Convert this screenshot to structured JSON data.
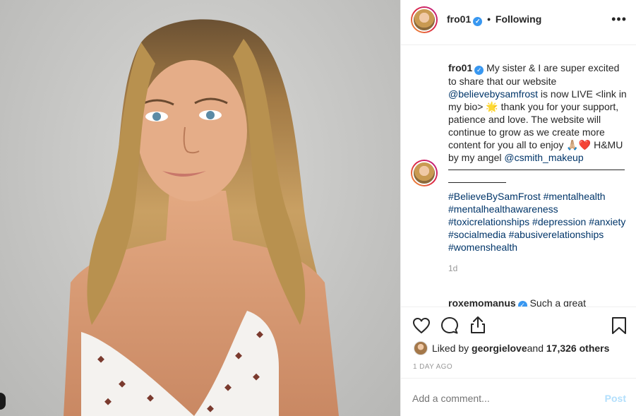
{
  "header": {
    "username": "fro01",
    "verified_mark": "✓",
    "separator": "•",
    "follow_status": "Following",
    "more_label": "•••"
  },
  "caption": {
    "username": "fro01",
    "verified_mark": "✓",
    "line1": "My sister & I are super excited to share that our website ",
    "mention1": "@believebysamfrost",
    "line2": " is now LIVE <link in my bio> ",
    "emoji1": "🌟",
    "line3": " thank you for your support, patience and love. The website will continue to grow as we create more content for you all to enjoy ",
    "emoji2": "🙏🏼",
    "emoji3": "❤️",
    "line4": " H&MU by my angel ",
    "mention2": "@csmith_makeup",
    "hashtags": "#BelieveBySamFrost #mentalhealth #mentalhealthawareness #toxicrelationships #depression #anxiety #socialmedia #abusiverelationships #womenshealth",
    "age": "1d"
  },
  "next_comment": {
    "username": "roxemomanus",
    "verified_mark": "✓",
    "text": "Such a great"
  },
  "actions": {
    "like_icon": "heart-icon",
    "comment_icon": "comment-icon",
    "share_icon": "share-icon",
    "save_icon": "bookmark-icon"
  },
  "likes": {
    "prefix": "Liked by ",
    "user": "georgielove",
    "middle": " and ",
    "count": "17,326 others"
  },
  "date": "1 DAY AGO",
  "comment_box": {
    "placeholder": "Add a comment...",
    "post_label": "Post"
  },
  "colors": {
    "link": "#003569",
    "verified": "#3897f0",
    "post_disabled": "#b2dffc",
    "border": "#efefef"
  }
}
